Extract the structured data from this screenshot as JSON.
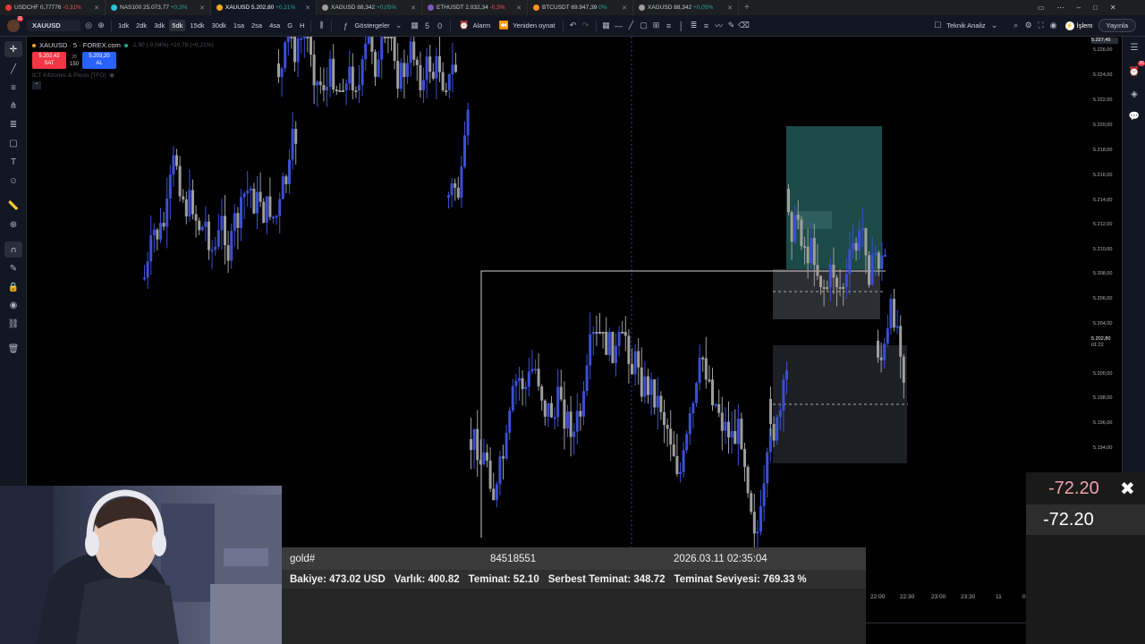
{
  "tabs": [
    {
      "symbol": "USDCHF",
      "price": "0,77776",
      "change": "-0,31%",
      "dir": "dn",
      "color": "#e53935"
    },
    {
      "symbol": "NAS100",
      "price": "25.073,77",
      "change": "+0,3%",
      "dir": "up",
      "color": "#26c6da"
    },
    {
      "symbol": "XAUUSD",
      "price": "5.202,80",
      "change": "+0,21%",
      "dir": "up",
      "color": "#f5a623",
      "active": true
    },
    {
      "symbol": "XAGUSD",
      "price": "88,342",
      "change": "+0,05%",
      "dir": "up",
      "color": "#9e9e9e"
    },
    {
      "symbol": "ETHUSDT",
      "price": "2.032,34",
      "change": "-0,3%",
      "dir": "dn",
      "color": "#7e57c2"
    },
    {
      "symbol": "BTCUSDT",
      "price": "69.947,39",
      "change": "0%",
      "dir": "up",
      "color": "#f7931a"
    },
    {
      "symbol": "XAGUSD",
      "price": "88,342",
      "change": "+0,05%",
      "dir": "up",
      "color": "#9e9e9e"
    }
  ],
  "toolbar": {
    "notif_count": "11",
    "symbol": "XAUUSD",
    "timeframes": [
      "1dk",
      "2dk",
      "3dk",
      "5dk",
      "15dk",
      "30dk",
      "1sa",
      "2sa",
      "4sa",
      "G",
      "H"
    ],
    "active_timeframe": "5dk",
    "indicators_label": "Göstergeler",
    "badge_a": "5",
    "badge_b": "0",
    "alarm_label": "Alarm",
    "replay_label": "Yeniden oynat",
    "tech_analysis_label": "Teknik Analiz",
    "trade_label": "İşlem",
    "publish_label": "Yayınla"
  },
  "legend": {
    "title": "XAUUSD · 5 · FOREX.com",
    "change": "-1,90 (-0,04%)  +10,78 (+0,21%)",
    "sell_price": "5.202,42",
    "sell_label": "SAT",
    "qty_top": "28",
    "qty": "150",
    "buy_price": "5.203,20",
    "buy_label": "AL",
    "indicator": "ICT Killzones & Pivots [TFO]"
  },
  "price_axis": {
    "labels": [
      "5.226,00",
      "5.224,00",
      "5.222,00",
      "5.220,00",
      "5.218,00",
      "5.216,00",
      "5.214,00",
      "5.212,00",
      "5.210,00",
      "5.208,00",
      "5.206,00",
      "5.204,00",
      "5.200,00",
      "5.198,00",
      "5.196,00",
      "5.194,00"
    ],
    "top_price": "5.227,45",
    "current_price": "5.202,80",
    "countdown": "01:22"
  },
  "chart_data": {
    "type": "candlestick",
    "symbol": "XAUUSD",
    "timeframe": "5",
    "ylim": [
      5190,
      5228
    ],
    "current_price": 5202.8
  },
  "overlay": {
    "symbol": "gold#",
    "account": "84518551",
    "datetime": "2026.03.11 02:35:04",
    "balance": "Bakiye: 473.02 USD",
    "equity": "Varlık: 400.82",
    "margin": "Teminat: 52.10",
    "free_margin": "Serbest Teminat: 348.72",
    "margin_level": "Teminat Seviyesi: 769.33 %",
    "pnl_top": "-72.20",
    "pnl_bottom": "-72.20"
  },
  "time_axis": [
    "22:00",
    "22:30",
    "23:00",
    "23:30",
    "11",
    "0"
  ]
}
